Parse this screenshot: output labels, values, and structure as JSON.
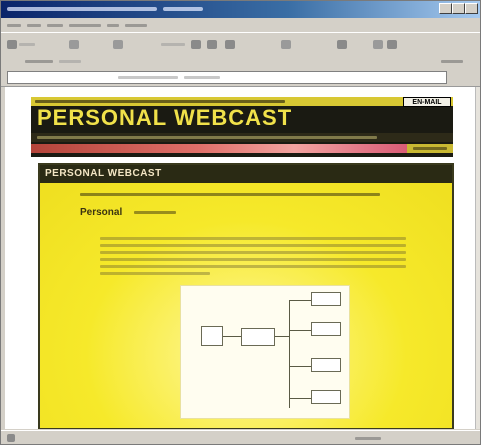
{
  "banner": {
    "title": "PERSONAL WEBCAST",
    "button_label": "EN-MAIL"
  },
  "panel": {
    "header": "PERSONAL WEBCAST",
    "section_title": "Personal"
  },
  "colors": {
    "panel_yellow": "#f7ea2a",
    "banner_dark": "#1a1a12",
    "title_yellow": "#f0e14a",
    "accent_red": "#d95c77",
    "window_chrome": "#d4d0c8",
    "titlebar_blue": "#0a246a"
  }
}
